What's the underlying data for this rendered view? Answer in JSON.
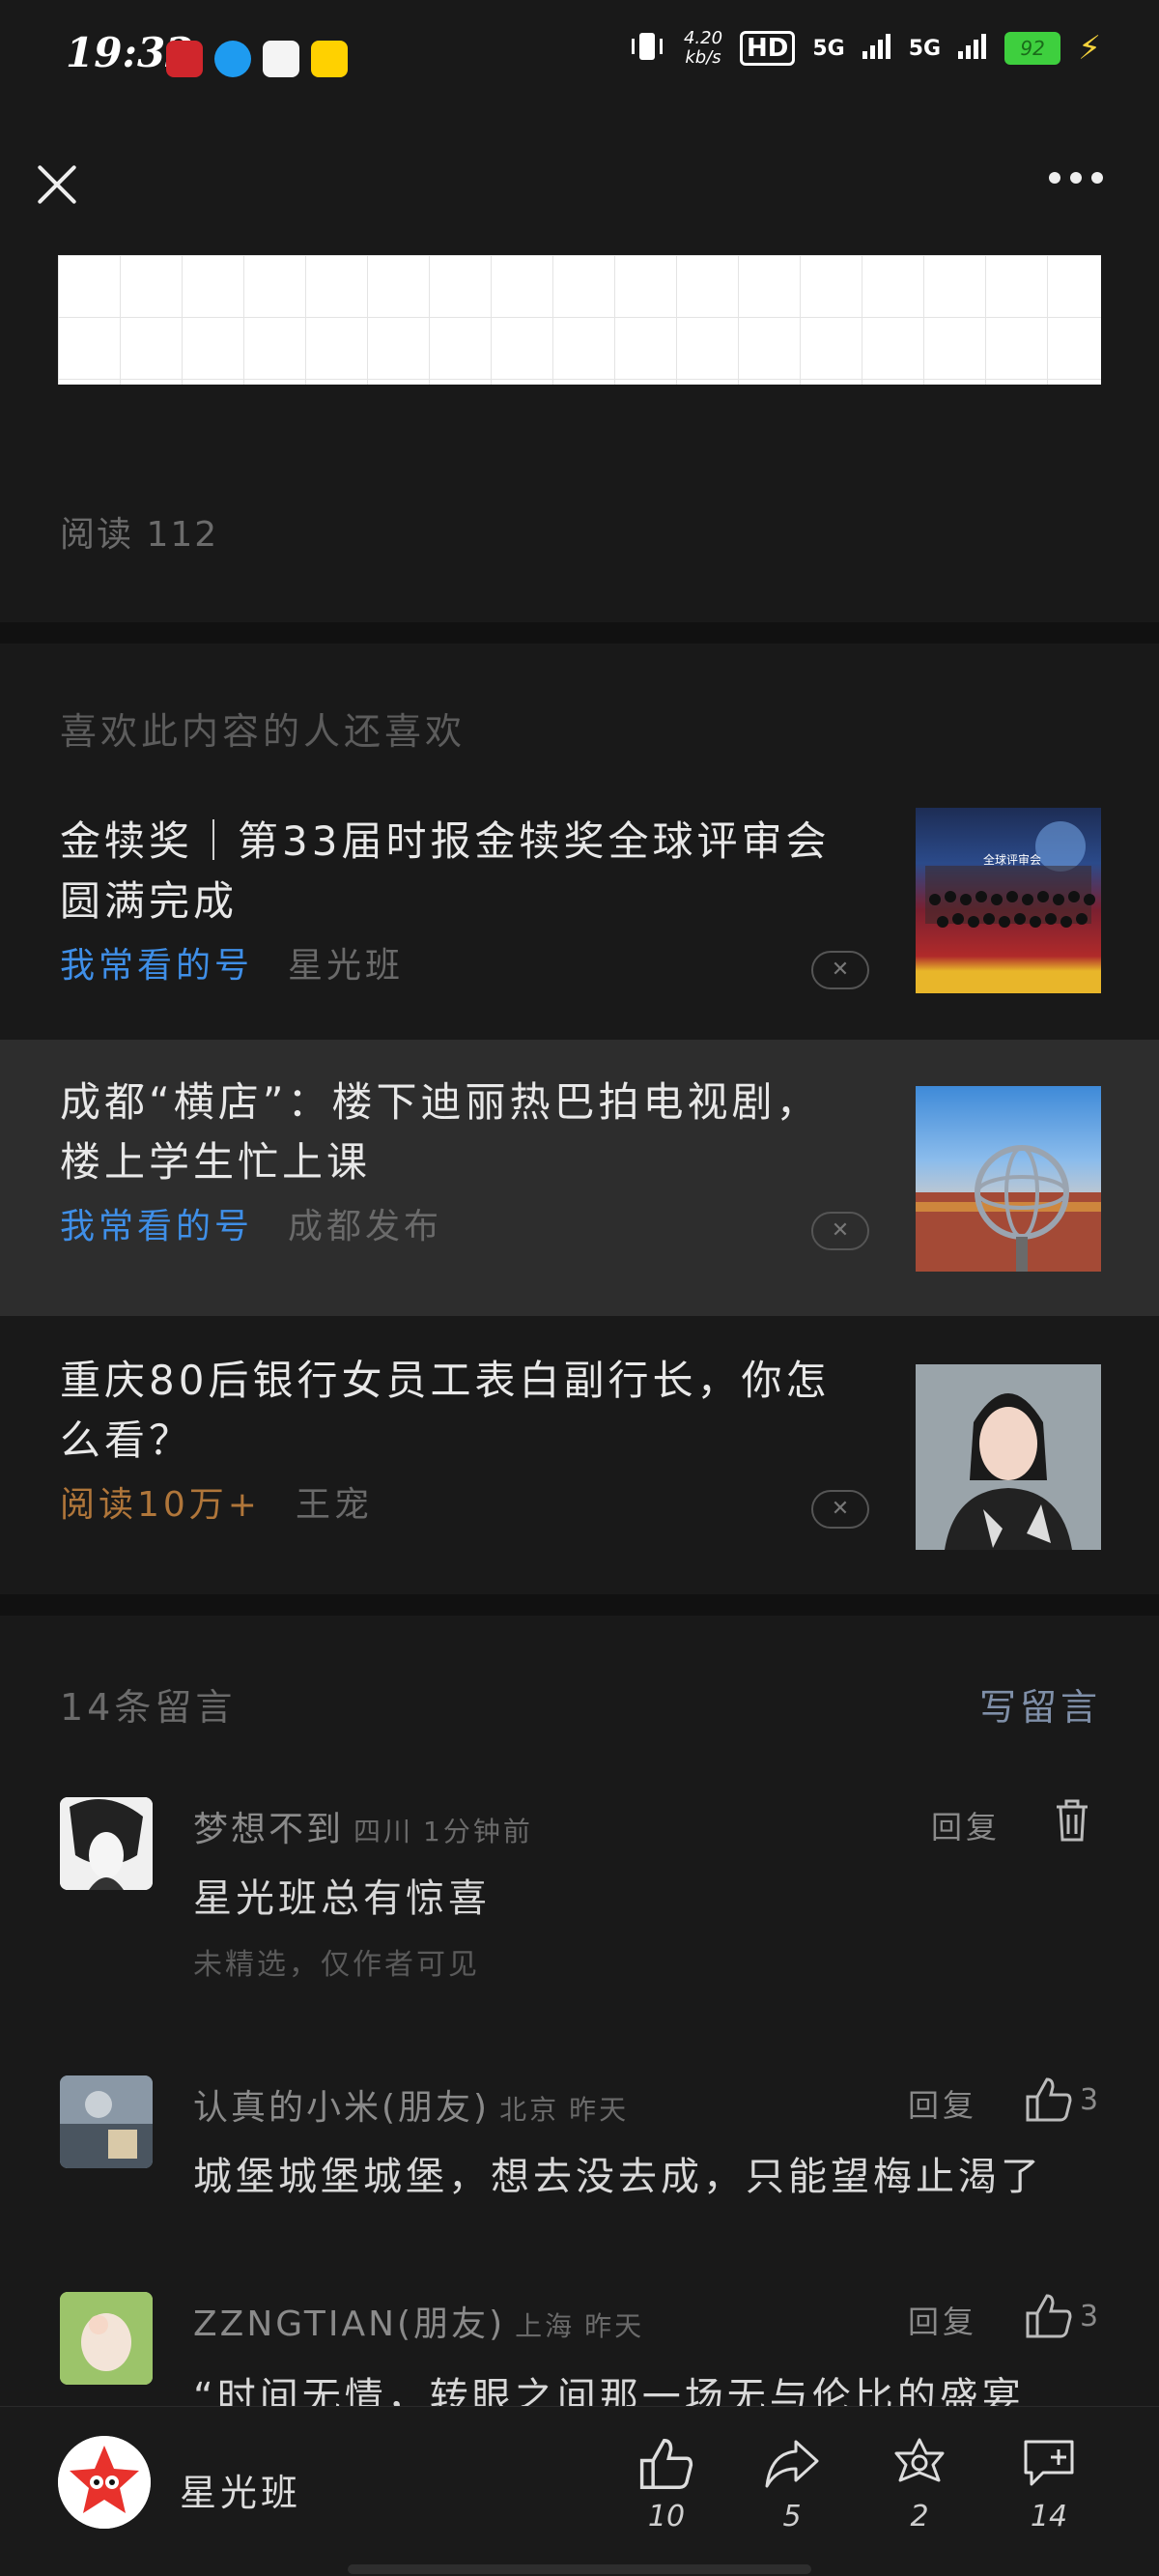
{
  "status_bar": {
    "time": "19:32",
    "net_speed_top": "4.20",
    "net_speed_bottom": "kb/s",
    "hd": "HD",
    "signal1": "5G",
    "signal2": "5G",
    "battery": "92"
  },
  "article": {
    "read_count": "阅读 112"
  },
  "recommend": {
    "title": "喜欢此内容的人还喜欢",
    "items": [
      {
        "title": "金犊奖｜第33届时报金犊奖全球评审会圆满完成",
        "tag": "我常看的号",
        "source": "星光班"
      },
      {
        "title": "成都“横店”：楼下迪丽热巴拍电视剧，楼上学生忙上课",
        "tag": "我常看的号",
        "source": "成都发布"
      },
      {
        "title": "重庆80后银行女员工表白副行长，你怎么看？",
        "tag": "阅读10万+",
        "source": "王宠"
      }
    ],
    "thumb1_caption": "全球评审会"
  },
  "comments": {
    "header": "14条留言",
    "write": "写留言",
    "reply_label": "回复",
    "items": [
      {
        "name": "梦想不到",
        "location": "四川",
        "time": "1分钟前",
        "text": "星光班总有惊喜",
        "sub": "未精选，仅作者可见"
      },
      {
        "name": "认真的小米(朋友)",
        "location": "北京",
        "time": "昨天",
        "text": "城堡城堡城堡，想去没去成，只能望梅止渴了",
        "likes": "3"
      },
      {
        "name": "ZZNGTIAN(朋友)",
        "location": "上海",
        "time": "昨天",
        "text": "“时间无情，转眼之间那一场无与伦比的盛宴",
        "likes": "3"
      }
    ]
  },
  "bottom_bar": {
    "account_name": "星光班",
    "like_count": "10",
    "share_count": "5",
    "favorite_count": "2",
    "comment_count": "14"
  }
}
